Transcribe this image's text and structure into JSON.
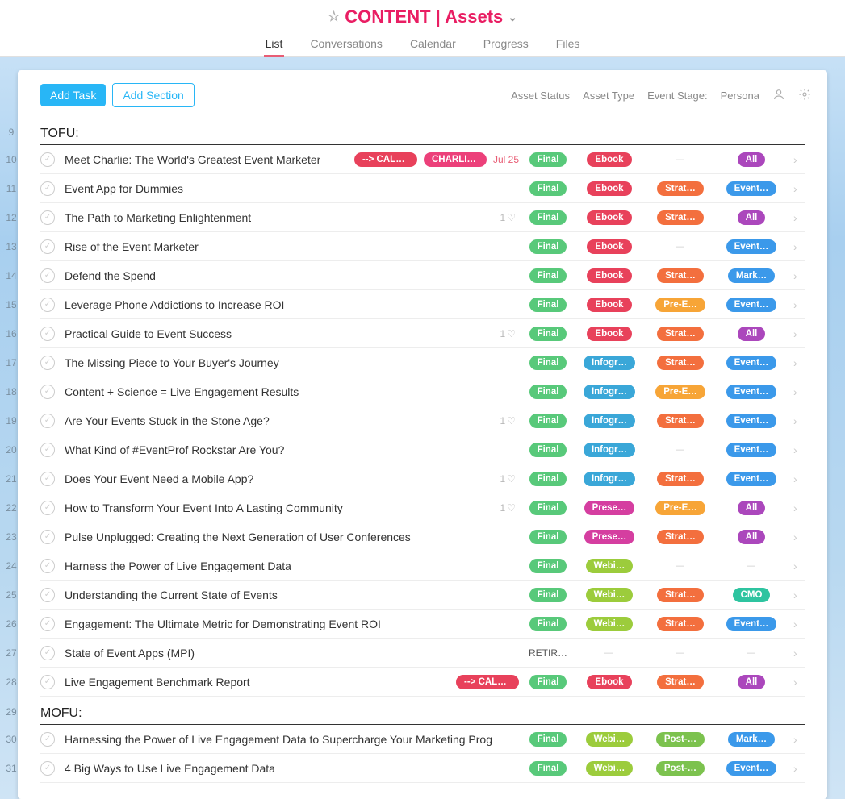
{
  "header": {
    "title": "CONTENT | Assets",
    "tabs": [
      "List",
      "Conversations",
      "Calendar",
      "Progress",
      "Files"
    ],
    "active_tab": 0
  },
  "toolbar": {
    "add_task": "Add Task",
    "add_section": "Add Section",
    "filters": [
      "Asset Status",
      "Asset Type",
      "Event Stage:",
      "Persona"
    ]
  },
  "sections": [
    {
      "rownum": 9,
      "label": "TOFU:",
      "tasks": [
        {
          "rownum": 10,
          "name": "Meet Charlie: The World's Greatest Event Marketer",
          "extra_pills": [
            {
              "text": "--> CALE…",
              "color": "c-red"
            },
            {
              "text": "CHARLIE …",
              "color": "c-pink"
            }
          ],
          "date": "Jul 25",
          "status": {
            "text": "Final",
            "color": "c-green"
          },
          "type": {
            "text": "Ebook",
            "color": "c-red"
          },
          "stage": null,
          "persona": {
            "text": "All",
            "color": "c-purple"
          }
        },
        {
          "rownum": 11,
          "name": "Event App for Dummies",
          "status": {
            "text": "Final",
            "color": "c-green"
          },
          "type": {
            "text": "Ebook",
            "color": "c-red"
          },
          "stage": {
            "text": "Strat…",
            "color": "c-orange"
          },
          "persona": {
            "text": "Event…",
            "color": "c-blue"
          }
        },
        {
          "rownum": 12,
          "name": "The Path to Marketing Enlightenment",
          "likes": 1,
          "status": {
            "text": "Final",
            "color": "c-green"
          },
          "type": {
            "text": "Ebook",
            "color": "c-red"
          },
          "stage": {
            "text": "Strat…",
            "color": "c-orange"
          },
          "persona": {
            "text": "All",
            "color": "c-purple"
          }
        },
        {
          "rownum": 13,
          "name": "Rise of the Event Marketer",
          "status": {
            "text": "Final",
            "color": "c-green"
          },
          "type": {
            "text": "Ebook",
            "color": "c-red"
          },
          "stage": null,
          "persona": {
            "text": "Event…",
            "color": "c-blue"
          }
        },
        {
          "rownum": 14,
          "name": "Defend the Spend",
          "status": {
            "text": "Final",
            "color": "c-green"
          },
          "type": {
            "text": "Ebook",
            "color": "c-red"
          },
          "stage": {
            "text": "Strat…",
            "color": "c-orange"
          },
          "persona": {
            "text": "Mark…",
            "color": "c-blue"
          }
        },
        {
          "rownum": 15,
          "name": "Leverage Phone Addictions to Increase ROI",
          "status": {
            "text": "Final",
            "color": "c-green"
          },
          "type": {
            "text": "Ebook",
            "color": "c-red"
          },
          "stage": {
            "text": "Pre-E…",
            "color": "c-amber"
          },
          "persona": {
            "text": "Event…",
            "color": "c-blue"
          }
        },
        {
          "rownum": 16,
          "name": "Practical Guide to Event Success",
          "likes": 1,
          "status": {
            "text": "Final",
            "color": "c-green"
          },
          "type": {
            "text": "Ebook",
            "color": "c-red"
          },
          "stage": {
            "text": "Strat…",
            "color": "c-orange"
          },
          "persona": {
            "text": "All",
            "color": "c-purple"
          }
        },
        {
          "rownum": 17,
          "name": "The Missing Piece to Your Buyer's Journey",
          "status": {
            "text": "Final",
            "color": "c-green"
          },
          "type": {
            "text": "Infogr…",
            "color": "c-cyan"
          },
          "stage": {
            "text": "Strat…",
            "color": "c-orange"
          },
          "persona": {
            "text": "Event…",
            "color": "c-blue"
          }
        },
        {
          "rownum": 18,
          "name": "Content + Science = Live Engagement Results",
          "status": {
            "text": "Final",
            "color": "c-green"
          },
          "type": {
            "text": "Infogr…",
            "color": "c-cyan"
          },
          "stage": {
            "text": "Pre-E…",
            "color": "c-amber"
          },
          "persona": {
            "text": "Event…",
            "color": "c-blue"
          }
        },
        {
          "rownum": 19,
          "name": "Are Your Events Stuck in the Stone Age?",
          "likes": 1,
          "status": {
            "text": "Final",
            "color": "c-green"
          },
          "type": {
            "text": "Infogr…",
            "color": "c-cyan"
          },
          "stage": {
            "text": "Strat…",
            "color": "c-orange"
          },
          "persona": {
            "text": "Event…",
            "color": "c-blue"
          }
        },
        {
          "rownum": 20,
          "name": "What Kind of #EventProf Rockstar Are You?",
          "status": {
            "text": "Final",
            "color": "c-green"
          },
          "type": {
            "text": "Infogr…",
            "color": "c-cyan"
          },
          "stage": null,
          "persona": {
            "text": "Event…",
            "color": "c-blue"
          }
        },
        {
          "rownum": 21,
          "name": "Does Your Event Need a Mobile App?",
          "likes": 1,
          "status": {
            "text": "Final",
            "color": "c-green"
          },
          "type": {
            "text": "Infogr…",
            "color": "c-cyan"
          },
          "stage": {
            "text": "Strat…",
            "color": "c-orange"
          },
          "persona": {
            "text": "Event…",
            "color": "c-blue"
          }
        },
        {
          "rownum": 22,
          "name": "How to Transform Your Event Into A Lasting Community",
          "likes": 1,
          "status": {
            "text": "Final",
            "color": "c-green"
          },
          "type": {
            "text": "Prese…",
            "color": "c-magenta"
          },
          "stage": {
            "text": "Pre-E…",
            "color": "c-amber"
          },
          "persona": {
            "text": "All",
            "color": "c-purple"
          }
        },
        {
          "rownum": 23,
          "name": "Pulse Unplugged: Creating the Next Generation of User Conferences",
          "status": {
            "text": "Final",
            "color": "c-green"
          },
          "type": {
            "text": "Prese…",
            "color": "c-magenta"
          },
          "stage": {
            "text": "Strat…",
            "color": "c-orange"
          },
          "persona": {
            "text": "All",
            "color": "c-purple"
          }
        },
        {
          "rownum": 24,
          "name": "Harness the Power of Live Engagement Data",
          "status": {
            "text": "Final",
            "color": "c-green"
          },
          "type": {
            "text": "Webi…",
            "color": "c-lime"
          },
          "stage": null,
          "persona": null
        },
        {
          "rownum": 25,
          "name": "Understanding the Current State of Events",
          "status": {
            "text": "Final",
            "color": "c-green"
          },
          "type": {
            "text": "Webi…",
            "color": "c-lime"
          },
          "stage": {
            "text": "Strat…",
            "color": "c-orange"
          },
          "persona": {
            "text": "CMO",
            "color": "c-mint"
          }
        },
        {
          "rownum": 26,
          "name": "Engagement: The Ultimate Metric for Demonstrating Event ROI",
          "status": {
            "text": "Final",
            "color": "c-green"
          },
          "type": {
            "text": "Webi…",
            "color": "c-lime"
          },
          "stage": {
            "text": "Strat…",
            "color": "c-orange"
          },
          "persona": {
            "text": "Event…",
            "color": "c-blue"
          }
        },
        {
          "rownum": 27,
          "name": "State of Event Apps (MPI)",
          "status_text": "RETIR…",
          "type": null,
          "stage": null,
          "persona": null
        },
        {
          "rownum": 28,
          "name": "Live Engagement Benchmark Report",
          "extra_pills": [
            {
              "text": "--> CALE…",
              "color": "c-red"
            }
          ],
          "status": {
            "text": "Final",
            "color": "c-green"
          },
          "type": {
            "text": "Ebook",
            "color": "c-red"
          },
          "stage": {
            "text": "Strat…",
            "color": "c-orange"
          },
          "persona": {
            "text": "All",
            "color": "c-purple"
          }
        }
      ]
    },
    {
      "rownum": 29,
      "label": "MOFU:",
      "tasks": [
        {
          "rownum": 30,
          "name": "Harnessing the Power of Live Engagement Data to Supercharge Your Marketing Prog",
          "status": {
            "text": "Final",
            "color": "c-green"
          },
          "type": {
            "text": "Webi…",
            "color": "c-lime"
          },
          "stage": {
            "text": "Post-…",
            "color": "c-limegreen"
          },
          "persona": {
            "text": "Mark…",
            "color": "c-blue"
          }
        },
        {
          "rownum": 31,
          "name": "4 Big Ways to Use Live Engagement Data",
          "status": {
            "text": "Final",
            "color": "c-green"
          },
          "type": {
            "text": "Webi…",
            "color": "c-lime"
          },
          "stage": {
            "text": "Post-…",
            "color": "c-limegreen"
          },
          "persona": {
            "text": "Event…",
            "color": "c-blue"
          }
        }
      ]
    }
  ]
}
